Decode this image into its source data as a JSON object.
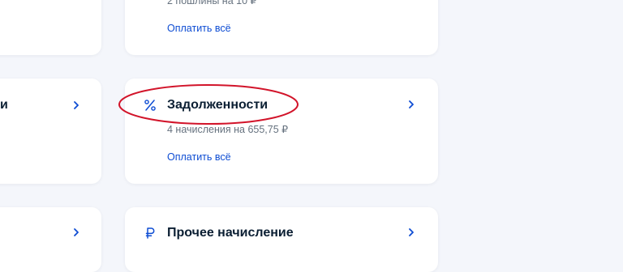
{
  "top_card": {
    "subtitle": "2 пошлины на 10 ₽",
    "pay_link": "Оплатить всё"
  },
  "left_mid_card": {
    "title_fragment": "и"
  },
  "debts_card": {
    "icon": "percent-icon",
    "title": "Задолженности",
    "subtitle": "4 начисления на 655,75 ₽",
    "pay_link": "Оплатить всё"
  },
  "other_card": {
    "icon": "ruble-icon",
    "title": "Прочее начисление"
  },
  "colors": {
    "accent": "#0d4cd3",
    "highlight_ellipse": "#d2142a",
    "background": "#f4f6fb"
  }
}
